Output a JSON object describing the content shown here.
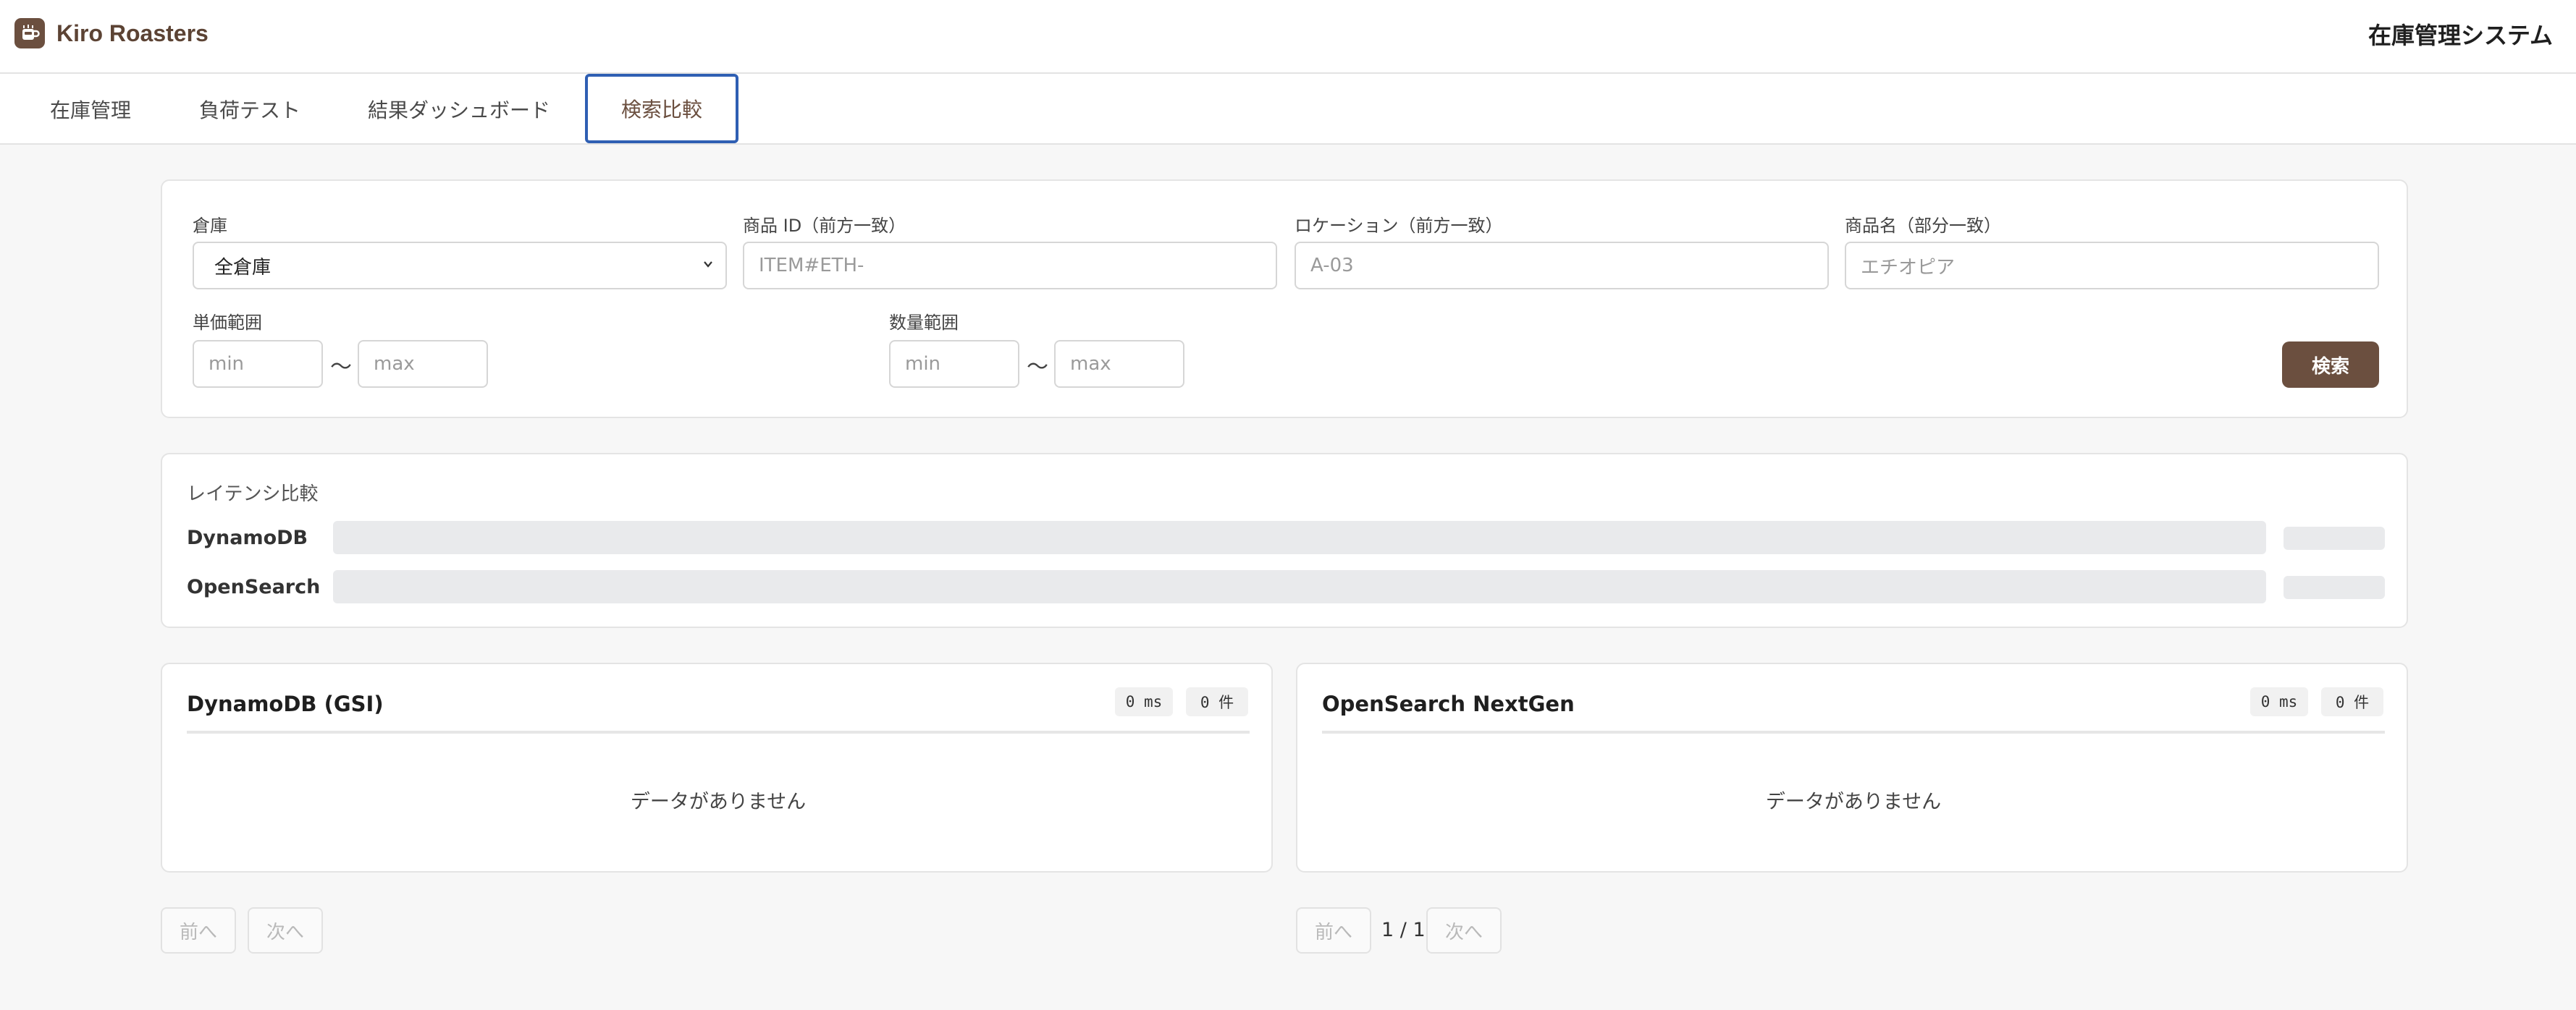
{
  "header": {
    "brand_name": "Kiro Roasters",
    "system_title": "在庫管理システム"
  },
  "tabs": [
    {
      "label": "在庫管理",
      "active": false
    },
    {
      "label": "負荷テスト",
      "active": false
    },
    {
      "label": "結果ダッシュボード",
      "active": false
    },
    {
      "label": "検索比較",
      "active": true
    }
  ],
  "filters": {
    "warehouse_label": "倉庫",
    "warehouse_value": "全倉庫",
    "item_id_label": "商品 ID（前方一致）",
    "item_id_value": "ITEM#ETH-",
    "location_label": "ロケーション（前方一致）",
    "location_value": "A-03",
    "item_name_label": "商品名（部分一致）",
    "item_name_placeholder": "エチオピア",
    "price_range_label": "単価範囲",
    "qty_range_label": "数量範囲",
    "min_placeholder": "min",
    "max_placeholder": "max",
    "range_separator": "〜",
    "search_button": "検索"
  },
  "latency": {
    "title": "レイテンシ比較",
    "rows": [
      {
        "name": "DynamoDB"
      },
      {
        "name": "OpenSearch"
      }
    ]
  },
  "results": [
    {
      "title": "DynamoDB (GSI)",
      "latency": "0 ms",
      "count": "0 件",
      "empty_text": "データがありません"
    },
    {
      "title": "OpenSearch NextGen",
      "latency": "0 ms",
      "count": "0 件",
      "empty_text": "データがありません"
    }
  ],
  "pagination": {
    "prev": "前へ",
    "next": "次へ",
    "page_info": "1 / 1"
  },
  "colors": {
    "accent": "#6b4f3f",
    "active_tab_border": "#2f5fb3"
  }
}
